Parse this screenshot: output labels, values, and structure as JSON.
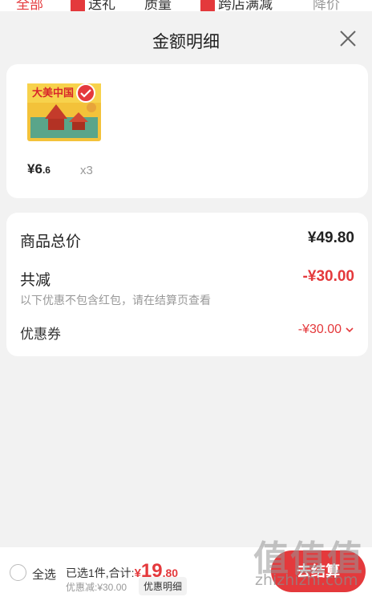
{
  "background_tabs": [
    {
      "label": "全部",
      "active": true
    },
    {
      "label": "送礼",
      "active": false
    },
    {
      "label": "质量",
      "active": false
    },
    {
      "label": "跨店满减",
      "active": false
    },
    {
      "label": "降价",
      "active": false
    }
  ],
  "sheet": {
    "title": "金额明细"
  },
  "product": {
    "image_alt": "大美中国",
    "price_symbol": "¥",
    "price_int": "6",
    "price_dec": ".6",
    "quantity": "x3"
  },
  "breakdown": {
    "total_label": "商品总价",
    "total_value": "¥49.80",
    "reduce_label": "共减",
    "reduce_value": "-¥30.00",
    "note": "以下优惠不包含红包，请在结算页查看",
    "coupon_label": "优惠券",
    "coupon_value": "-¥30.00"
  },
  "bottom_bar": {
    "select_all": "全选",
    "selected_text": "已选1件,合计:",
    "currency": "¥",
    "sum_int": "19",
    "sum_dec": ".80",
    "discount_text": "优惠减:¥30.00",
    "detail_link": "优惠明细",
    "checkout": "去结算"
  },
  "watermark": {
    "logo": "值值值",
    "text": "zhizhizhi.com"
  },
  "colors": {
    "accent": "#e4393c",
    "muted": "#999999"
  },
  "icons": {
    "close": "close-icon",
    "check": "check-icon",
    "chevron": "chevron-down-icon"
  }
}
